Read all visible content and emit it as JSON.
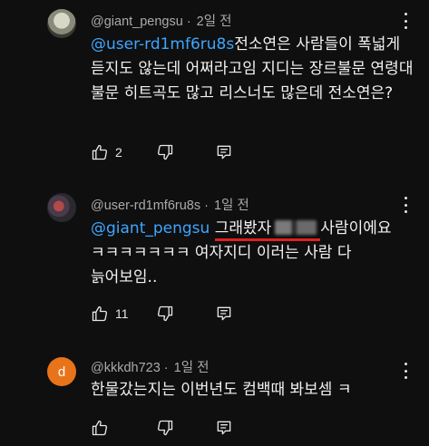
{
  "comments": [
    {
      "author": "@giant_pengsu",
      "time": "2일 전",
      "mention": "@user-rd1mf6ru8s",
      "text": "전소연은 사람들이 폭넓게 듣지도 않는데 어쩌라고임 지디는 장르불문 연령대 불문 히트곡도 많고 리스너도 많은데 전소연은?",
      "likes": "2"
    },
    {
      "author": "@user-rd1mf6ru8s",
      "time": "1일 전",
      "mention": "@giant_pengsu",
      "text_underlined": "그래봤자",
      "text_after": "사람이에요 ㅋㅋㅋㅋㅋㅋㅋ 여자지디 이러는 사람 다 늙어보임..",
      "likes": "11"
    },
    {
      "author": "@kkkdh723",
      "time": "1일 전",
      "avatar_letter": "d",
      "text": "한물갔는지는 이번년도 컴백때 봐보셈 ㅋ",
      "likes": ""
    }
  ],
  "icons": {
    "like": "thumbs-up-icon",
    "dislike": "thumbs-down-icon",
    "reply": "reply-icon",
    "menu": "more-vert-icon"
  },
  "colors": {
    "background": "#0f0f0f",
    "mention": "#3ea6ff",
    "underline": "#e02020",
    "avatar_d": "#e8731a"
  }
}
